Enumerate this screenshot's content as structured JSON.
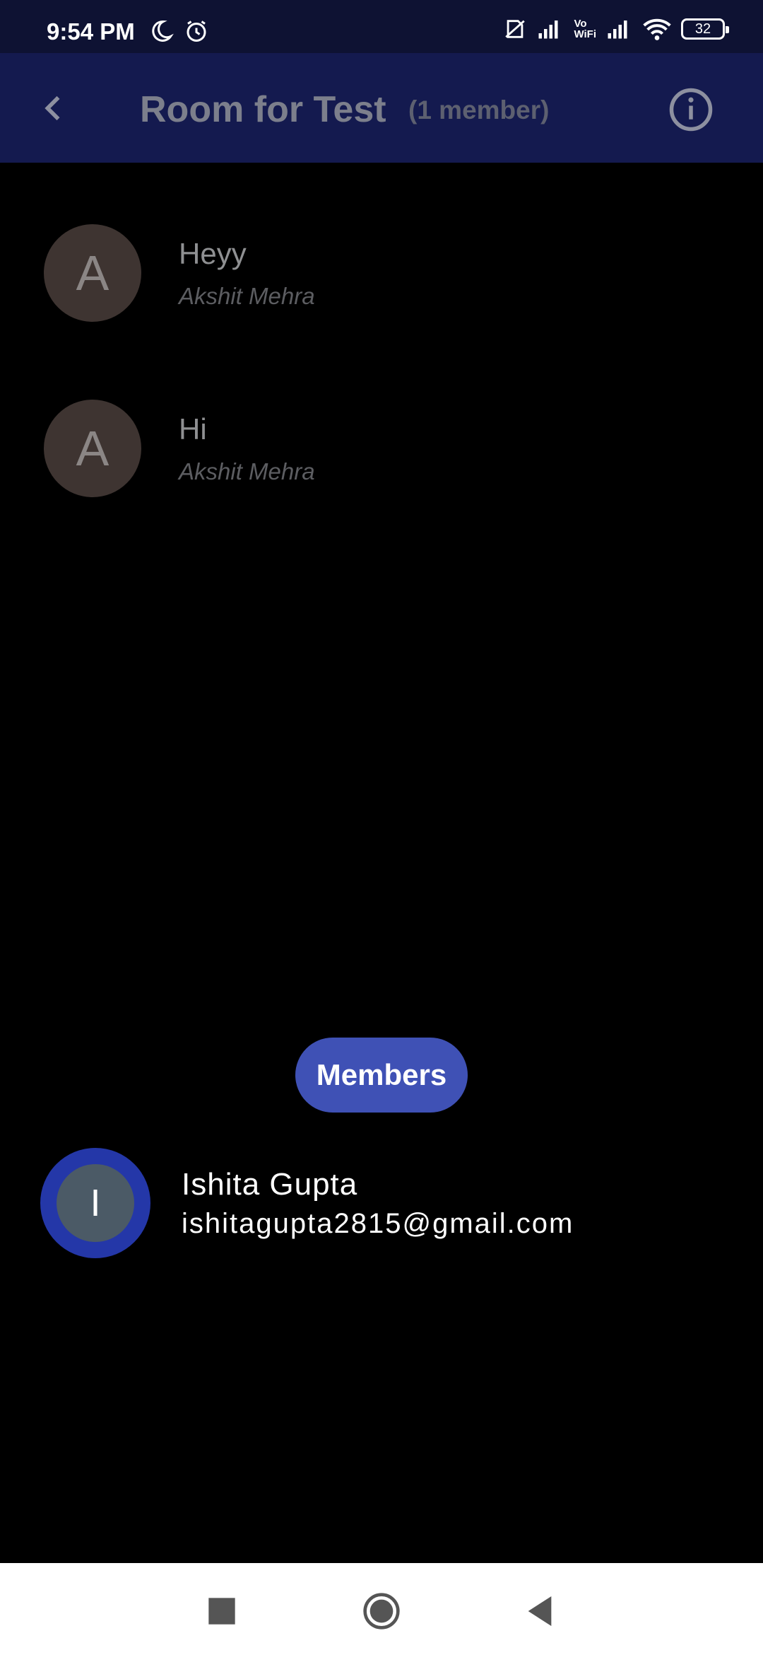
{
  "status_bar": {
    "time": "9:54 PM",
    "left_icons": [
      "moon-icon",
      "alarm-icon"
    ],
    "right_icons": [
      "no-sim-icon",
      "signal-icon",
      "vowifi-icon",
      "signal-icon",
      "wifi-icon"
    ],
    "vowifi_top": "Vo",
    "vowifi_bottom": "WiFi",
    "battery": "32"
  },
  "app_bar": {
    "title": "Room for Test",
    "subtitle": "(1 member)",
    "back_icon": "chevron-left-icon",
    "info_icon": "info-icon"
  },
  "messages": [
    {
      "avatar_letter": "A",
      "text": "Heyy",
      "sender": "Akshit Mehra"
    },
    {
      "avatar_letter": "A",
      "text": "Hi",
      "sender": "Akshit Mehra"
    }
  ],
  "members_label": "Members",
  "members": [
    {
      "avatar_letter": "I",
      "name": "Ishita Gupta",
      "email": "ishitagupta2815@gmail.com"
    }
  ],
  "nav_bar": {
    "icons": [
      "recents-icon",
      "home-icon",
      "back-icon"
    ]
  },
  "colors": {
    "status_bar_bg": "#0e1233",
    "app_bar_bg": "#141a4f",
    "accent": "#3f51b5",
    "avatar_bg": "#3e3431",
    "background": "#000000"
  }
}
